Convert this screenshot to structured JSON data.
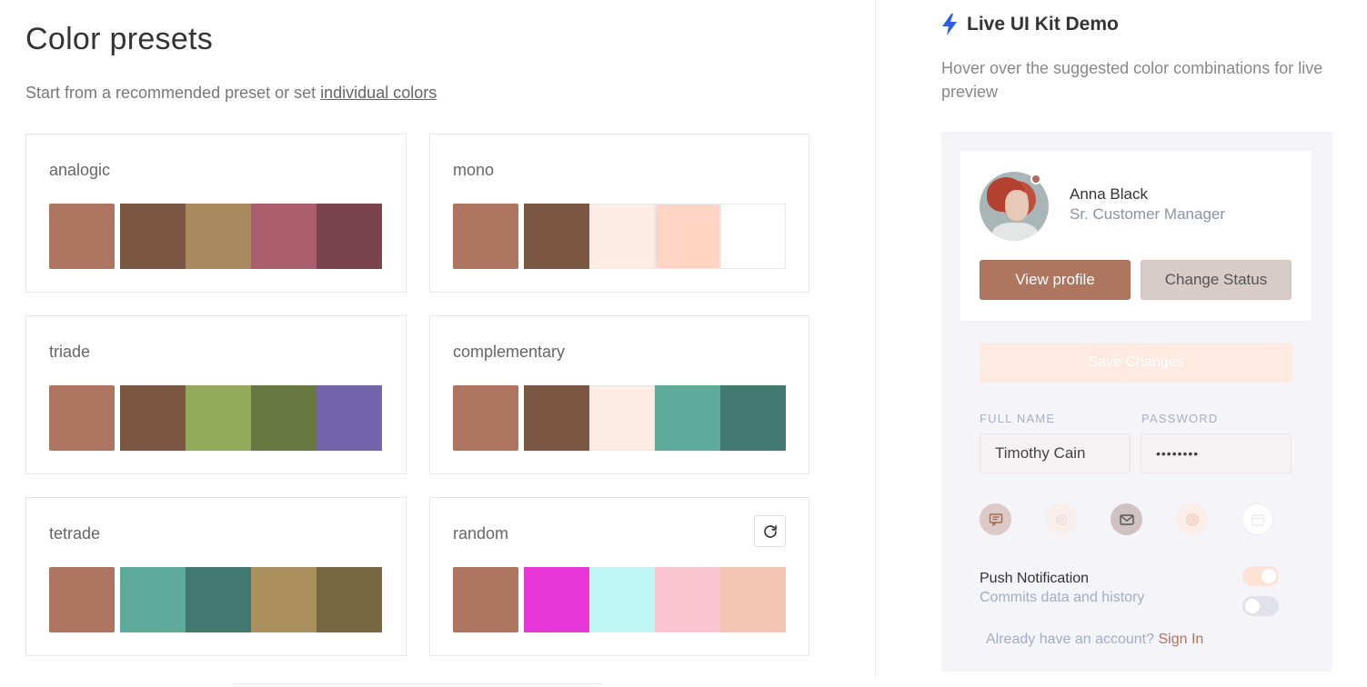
{
  "page": {
    "title": "Color presets",
    "subtitle_text": "Start from a recommended preset or set",
    "subtitle_link": "individual colors"
  },
  "presets": [
    {
      "name": "analogic",
      "colors": [
        "#ad7560",
        "#7b5743",
        "#a9895e",
        "#ab5e6b",
        "#7a434d"
      ]
    },
    {
      "name": "mono",
      "colors": [
        "#ad7560",
        "#7b5743",
        "#feebe1",
        "#ffd6c4",
        "#ffffff"
      ]
    },
    {
      "name": "triade",
      "colors": [
        "#ad7560",
        "#7b5743",
        "#94ab5e",
        "#677841",
        "#7365ab"
      ]
    },
    {
      "name": "complementary",
      "colors": [
        "#ad7560",
        "#7b5743",
        "#feebe1",
        "#5eab9c",
        "#417870"
      ]
    },
    {
      "name": "tetrade",
      "colors": [
        "#ad7560",
        "#5eab9c",
        "#417870",
        "#ab905e",
        "#786741"
      ]
    },
    {
      "name": "random",
      "colors": [
        "#ad7560",
        "#e837d9",
        "#bdf6f4",
        "#fac4d0",
        "#f3c3b3"
      ]
    }
  ],
  "demo": {
    "title": "Live UI Kit Demo",
    "description": "Hover over the suggested color combinations for live preview",
    "profile": {
      "name": "Anna Black",
      "role": "Sr. Customer Manager"
    },
    "view_profile": "View profile",
    "change_status": "Change Status",
    "save_changes": "Save Changes",
    "full_name_label": "FULL NAME",
    "full_name_value": "Timothy Cain",
    "password_label": "PASSWORD",
    "password_value": "••••••••",
    "push_notification": "Push Notification",
    "commits_text": "Commits data and history",
    "account_text": "Already have an account?",
    "sign_in": "Sign In"
  },
  "icons": [
    "chat-icon",
    "settings-icon",
    "mail-icon",
    "target-icon",
    "calendar-icon"
  ],
  "accent": "#ad7560"
}
